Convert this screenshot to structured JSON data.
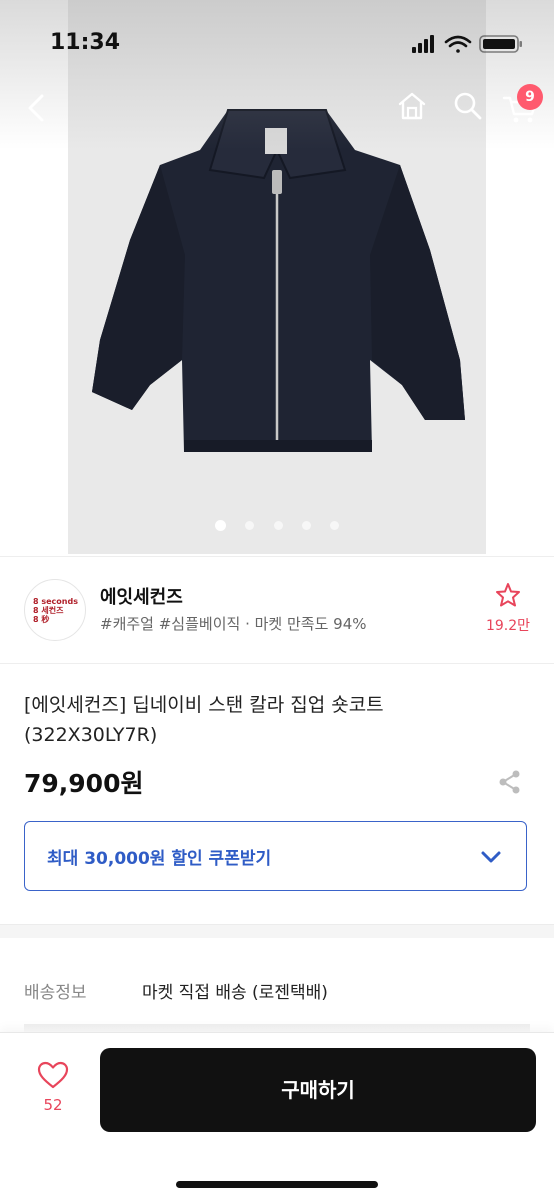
{
  "status_bar": {
    "time": "11:34"
  },
  "nav": {
    "back_icon": "chevron-left-icon",
    "home_icon": "home-icon",
    "search_icon": "search-icon",
    "cart_icon": "cart-icon",
    "cart_badge": "9"
  },
  "gallery": {
    "image_count": 5,
    "active_index": 0
  },
  "seller": {
    "logo_lines": [
      "8 seconds",
      "8 세컨즈",
      "8 秒"
    ],
    "name": "에잇세컨즈",
    "meta": "#캐주얼 #심플베이직 · 마켓 만족도 94%",
    "favorite_count": "19.2만"
  },
  "product": {
    "title_line1": "[에잇세컨즈] 딥네이비 스탠 칼라 집업 숏코트",
    "title_line2": "(322X30LY7R)",
    "price": "79,900원"
  },
  "coupon": {
    "label": "최대 30,000원 할인 쿠폰받기"
  },
  "shipping": {
    "label": "배송정보",
    "value": "마켓 직접 배송 (로젠택배)"
  },
  "bottom_bar": {
    "like_count": "52",
    "buy_label": "구매하기"
  },
  "colors": {
    "accent_red": "#e8455b",
    "coupon_blue": "#2f5cc6",
    "buy_bg": "#111111",
    "jacket_navy": "#1f2433"
  }
}
